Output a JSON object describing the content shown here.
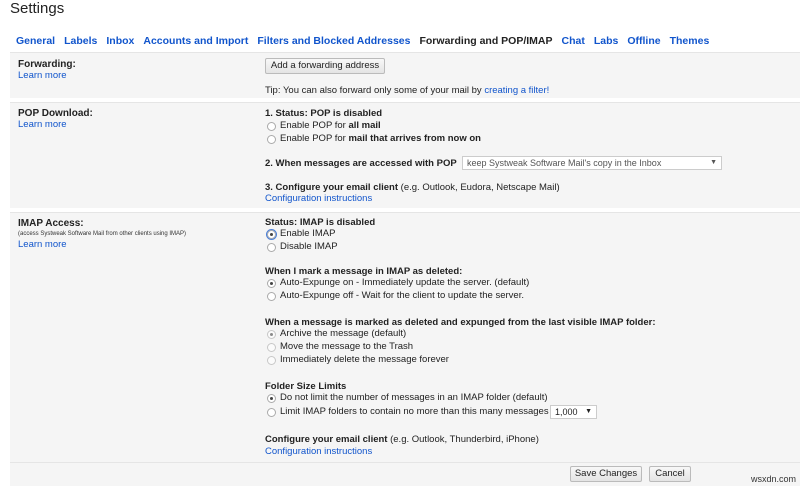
{
  "page": {
    "title": "Settings"
  },
  "tabs": [
    {
      "label": "General"
    },
    {
      "label": "Labels"
    },
    {
      "label": "Inbox"
    },
    {
      "label": "Accounts and Import"
    },
    {
      "label": "Filters and Blocked Addresses"
    },
    {
      "label": "Forwarding and POP/IMAP",
      "active": true
    },
    {
      "label": "Chat"
    },
    {
      "label": "Labs"
    },
    {
      "label": "Offline"
    },
    {
      "label": "Themes"
    }
  ],
  "forwarding": {
    "label": "Forwarding:",
    "learn_more": "Learn more",
    "add_button": "Add a forwarding address",
    "tip_prefix": "Tip: You can also forward only some of your mail by ",
    "tip_link": "creating a filter!"
  },
  "pop": {
    "label": "POP Download:",
    "learn_more": "Learn more",
    "status": "1. Status: POP is disabled",
    "opt1_prefix": "Enable POP for ",
    "opt1_bold": "all mail",
    "opt2_prefix": "Enable POP for ",
    "opt2_bold": "mail that arrives from now on",
    "access_label": "2. When messages are accessed with POP",
    "access_select": "keep Systweak Software Mail's copy in the Inbox",
    "configure_bold": "3. Configure your email client",
    "configure_rest": " (e.g. Outlook, Eudora, Netscape Mail)",
    "configure_link": "Configuration instructions"
  },
  "imap": {
    "label": "IMAP Access:",
    "note": "(access Systweak Software Mail from other clients using IMAP)",
    "learn_more": "Learn more",
    "status": "Status: IMAP is disabled",
    "enable": "Enable IMAP",
    "disable": "Disable IMAP",
    "deleted_heading": "When I mark a message in IMAP as deleted:",
    "expunge_on": "Auto-Expunge on - Immediately update the server. (default)",
    "expunge_off": "Auto-Expunge off - Wait for the client to update the server.",
    "expunged_heading": "When a message is marked as deleted and expunged from the last visible IMAP folder:",
    "archive": "Archive the message (default)",
    "trash": "Move the message to the Trash",
    "delete_forever": "Immediately delete the message forever",
    "folder_heading": "Folder Size Limits",
    "no_limit": "Do not limit the number of messages in an IMAP folder (default)",
    "limit": "Limit IMAP folders to contain no more than this many messages",
    "limit_select": "1,000",
    "configure_bold": "Configure your email client",
    "configure_rest": " (e.g. Outlook, Thunderbird, iPhone)",
    "configure_link": "Configuration instructions"
  },
  "footer": {
    "save": "Save Changes",
    "cancel": "Cancel"
  },
  "watermark": "wsxdn.com"
}
